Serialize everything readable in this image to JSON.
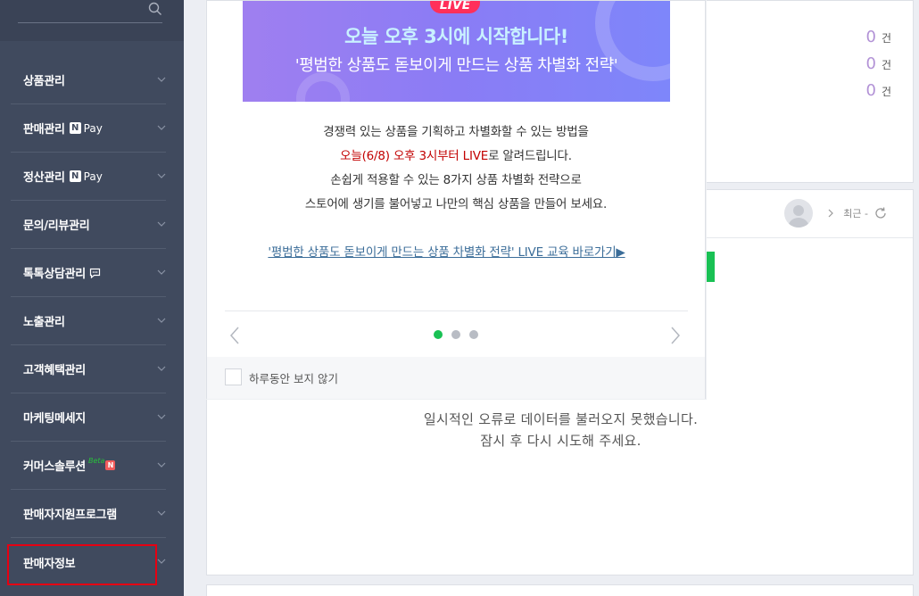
{
  "sidebar": {
    "search": {
      "value": "",
      "placeholder": ""
    },
    "items": [
      {
        "label": "상품관리"
      },
      {
        "label": "판매관리",
        "badge": "Pay"
      },
      {
        "label": "정산관리",
        "badge": "Pay"
      },
      {
        "label": "문의/리뷰관리"
      },
      {
        "label": "톡톡상담관리"
      },
      {
        "label": "노출관리"
      },
      {
        "label": "고객혜택관리"
      },
      {
        "label": "마케팅메세지"
      },
      {
        "label": "커머스솔루션",
        "badge": "Beta"
      },
      {
        "label": "판매자지원프로그램"
      },
      {
        "label": "판매자정보"
      }
    ],
    "npay_letter": "N",
    "beta_letter": "N"
  },
  "summary": {
    "rows": [
      {
        "count": "0",
        "unit": "건"
      },
      {
        "count": "0",
        "unit": "건"
      },
      {
        "count": "0",
        "unit": "건"
      }
    ]
  },
  "panel": {
    "recent_label": "최근 -",
    "error_line1": "일시적인 오류로 데이터를 불러오지 못했습니다.",
    "error_line2": "잠시 후 다시 시도해 주세요."
  },
  "popup": {
    "live_badge": "LIVE",
    "banner_line1": "오늘 오후 3시에 시작합니다!",
    "banner_line2": "'평범한 상품도 돋보이게 만드는 상품 차별화 전략'",
    "desc_line1": "경쟁력 있는 상품을 기획하고 차별화할 수 있는 방법을",
    "desc_line2_red": "오늘(6/8) 오후 3시부터 LIVE",
    "desc_line2_rest": "로 알려드립니다.",
    "desc_line3": "손쉽게 적용할 수 있는 8가지 상품 차별화 전략으로",
    "desc_line4": "스토어에 생기를 불어넣고 나만의 핵심 상품을 만들어 보세요.",
    "link_text": "'평범한 상품도 돋보이게 만드는 상품 차별화 전략' LIVE 교육 바로가기▶",
    "pagination": {
      "current": 1,
      "total": 3
    },
    "dont_show_label": "하루동안 보지 않기"
  },
  "colors": {
    "sidebar_bg": "#404a5e",
    "accent_green": "#19c154",
    "count_purple": "#b292d6",
    "highlight_red": "#e60012"
  },
  "icons": [
    "search-icon",
    "chevron-down-icon",
    "chat-icon",
    "avatar-icon",
    "chevron-right-icon",
    "refresh-icon",
    "arrow-left-icon",
    "arrow-right-icon"
  ]
}
